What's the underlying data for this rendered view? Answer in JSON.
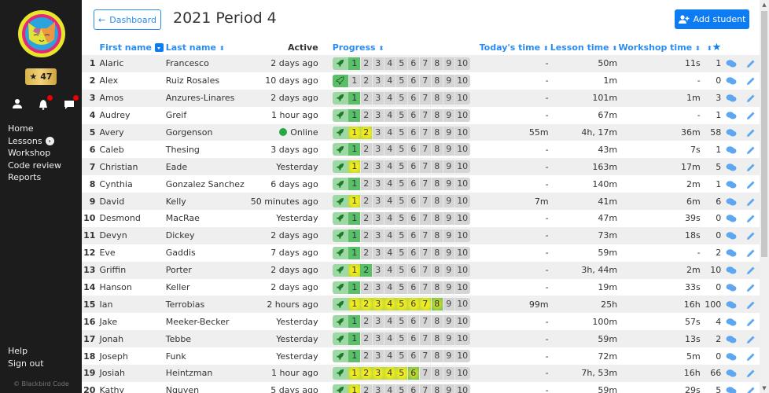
{
  "sidebar": {
    "stars": "47",
    "nav": [
      {
        "label": "Home"
      },
      {
        "label": "Lessons"
      },
      {
        "label": "Workshop"
      },
      {
        "label": "Code review"
      },
      {
        "label": "Reports"
      }
    ],
    "bottom_nav": [
      {
        "label": "Help"
      },
      {
        "label": "Sign out"
      }
    ],
    "copyright": "© Blackbird Code"
  },
  "header": {
    "back_label": "Dashboard",
    "title": "2021 Period 4",
    "add_label": "Add student"
  },
  "table": {
    "columns": {
      "first": "First name",
      "last": "Last name",
      "active": "Active",
      "progress": "Progress",
      "today": "Today's time",
      "lesson": "Lesson time",
      "workshop": "Workshop time"
    },
    "progress_levels": [
      "1",
      "2",
      "3",
      "4",
      "5",
      "6",
      "7",
      "8",
      "9",
      "10"
    ],
    "rows": [
      {
        "n": "1",
        "first": "Alaric",
        "last": "Francesco",
        "active": "2 days ago",
        "prog": [
          "g"
        ],
        "today": "-",
        "lesson": "50m",
        "workshop": "11s",
        "stars": "1"
      },
      {
        "n": "2",
        "first": "Alex",
        "last": "Ruiz Rosales",
        "active": "10 days ago",
        "prog": [],
        "rocket_solid": true,
        "today": "-",
        "lesson": "1m",
        "workshop": "-",
        "stars": "0"
      },
      {
        "n": "3",
        "first": "Amos",
        "last": "Anzures-Linares",
        "active": "2 days ago",
        "prog": [
          "g"
        ],
        "today": "-",
        "lesson": "101m",
        "workshop": "1m",
        "stars": "3"
      },
      {
        "n": "4",
        "first": "Audrey",
        "last": "Greif",
        "active": "1 hour ago",
        "prog": [
          "g"
        ],
        "today": "-",
        "lesson": "67m",
        "workshop": "-",
        "stars": "1"
      },
      {
        "n": "5",
        "first": "Avery",
        "last": "Gorgenson",
        "active": "Online",
        "online": true,
        "prog": [
          "y",
          "y"
        ],
        "today": "55m",
        "lesson": "4h, 17m",
        "workshop": "36m",
        "stars": "58"
      },
      {
        "n": "6",
        "first": "Caleb",
        "last": "Thesing",
        "active": "3 days ago",
        "prog": [
          "g"
        ],
        "today": "-",
        "lesson": "43m",
        "workshop": "7s",
        "stars": "1"
      },
      {
        "n": "7",
        "first": "Christian",
        "last": "Eade",
        "active": "Yesterday",
        "prog": [
          "y"
        ],
        "today": "-",
        "lesson": "163m",
        "workshop": "17m",
        "stars": "5"
      },
      {
        "n": "8",
        "first": "Cynthia",
        "last": "Gonzalez Sanchez",
        "active": "6 days ago",
        "prog": [
          "g"
        ],
        "today": "-",
        "lesson": "140m",
        "workshop": "2m",
        "stars": "1"
      },
      {
        "n": "9",
        "first": "David",
        "last": "Kelly",
        "active": "50 minutes ago",
        "prog": [
          "y"
        ],
        "today": "7m",
        "lesson": "41m",
        "workshop": "6m",
        "stars": "6"
      },
      {
        "n": "10",
        "first": "Desmond",
        "last": "MacRae",
        "active": "Yesterday",
        "prog": [
          "g"
        ],
        "today": "-",
        "lesson": "47m",
        "workshop": "39s",
        "stars": "0"
      },
      {
        "n": "11",
        "first": "Devyn",
        "last": "Dickey",
        "active": "2 days ago",
        "prog": [
          "g"
        ],
        "today": "-",
        "lesson": "73m",
        "workshop": "18s",
        "stars": "0"
      },
      {
        "n": "12",
        "first": "Eve",
        "last": "Gaddis",
        "active": "7 days ago",
        "prog": [
          "g"
        ],
        "today": "-",
        "lesson": "59m",
        "workshop": "-",
        "stars": "2"
      },
      {
        "n": "13",
        "first": "Griffin",
        "last": "Porter",
        "active": "2 days ago",
        "prog": [
          "y",
          "g"
        ],
        "today": "-",
        "lesson": "3h, 44m",
        "workshop": "2m",
        "stars": "10"
      },
      {
        "n": "14",
        "first": "Hanson",
        "last": "Keller",
        "active": "2 days ago",
        "prog": [
          "g"
        ],
        "today": "-",
        "lesson": "19m",
        "workshop": "33s",
        "stars": "0"
      },
      {
        "n": "15",
        "first": "Ian",
        "last": "Terrobias",
        "active": "2 hours ago",
        "prog": [
          "y",
          "y",
          "y",
          "y",
          "y",
          "y",
          "y",
          "yg"
        ],
        "today": "99m",
        "lesson": "25h",
        "workshop": "16h",
        "stars": "100"
      },
      {
        "n": "16",
        "first": "Jake",
        "last": "Meeker-Becker",
        "active": "Yesterday",
        "prog": [
          "g"
        ],
        "today": "-",
        "lesson": "100m",
        "workshop": "57s",
        "stars": "4"
      },
      {
        "n": "17",
        "first": "Jonah",
        "last": "Tebbe",
        "active": "Yesterday",
        "prog": [
          "g"
        ],
        "today": "-",
        "lesson": "59m",
        "workshop": "13s",
        "stars": "2"
      },
      {
        "n": "18",
        "first": "Joseph",
        "last": "Funk",
        "active": "Yesterday",
        "prog": [
          "g"
        ],
        "today": "-",
        "lesson": "72m",
        "workshop": "5m",
        "stars": "0"
      },
      {
        "n": "19",
        "first": "Josiah",
        "last": "Heintzman",
        "active": "1 hour ago",
        "prog": [
          "y",
          "y",
          "y",
          "y",
          "y",
          "yg"
        ],
        "today": "-",
        "lesson": "7h, 53m",
        "workshop": "16h",
        "stars": "66"
      },
      {
        "n": "20",
        "first": "Kathy",
        "last": "Nguyen",
        "active": "5 days ago",
        "prog": [
          "y"
        ],
        "today": "-",
        "lesson": "59m",
        "workshop": "29s",
        "stars": "5"
      }
    ]
  },
  "colors": {
    "accent": "#0d7bf2",
    "link": "#2a8cf0",
    "sidebar": "#1c1c1c",
    "complete": "#5bbf67",
    "online": "#27a844"
  }
}
